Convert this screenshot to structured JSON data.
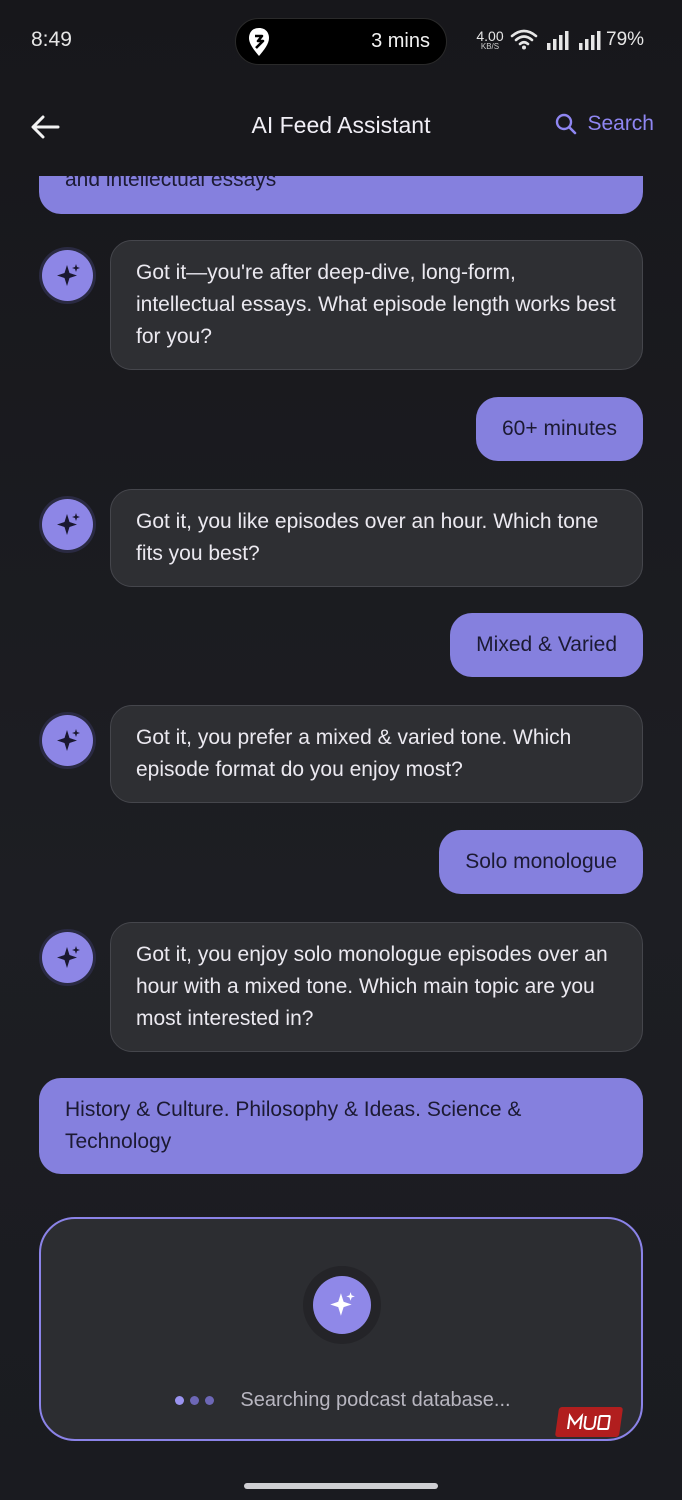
{
  "status_bar": {
    "time": "8:49",
    "live_activity": "3 mins",
    "net_speed_value": "4.00",
    "net_speed_unit": "KB/S",
    "battery": "79%"
  },
  "app_bar": {
    "title": "AI Feed Assistant",
    "search_label": "Search"
  },
  "messages": [
    {
      "role": "user",
      "text": "and intellectual essays"
    },
    {
      "role": "assistant",
      "text": "Got it—you're after deep-dive, long-form, intellectual essays. What episode length works best for you?"
    },
    {
      "role": "user",
      "text": "60+ minutes"
    },
    {
      "role": "assistant",
      "text": "Got it, you like episodes over an hour. Which tone fits you best?"
    },
    {
      "role": "user",
      "text": "Mixed & Varied"
    },
    {
      "role": "assistant",
      "text": "Got it, you prefer a mixed & varied tone. Which episode format do you enjoy most?"
    },
    {
      "role": "user",
      "text": "Solo monologue"
    },
    {
      "role": "assistant",
      "text": "Got it, you enjoy solo monologue episodes over an hour with a mixed tone. Which main topic are you most interested in?"
    },
    {
      "role": "user",
      "text": "History & Culture. Philosophy & Ideas. Science & Technology"
    }
  ],
  "loading": {
    "text": "Searching podcast database..."
  },
  "watermark": "MUO",
  "colors": {
    "accent": "#8f86f2",
    "user_bubble": "#8580de",
    "assistant_bubble": "#2e2f33",
    "background": "#17181c"
  }
}
